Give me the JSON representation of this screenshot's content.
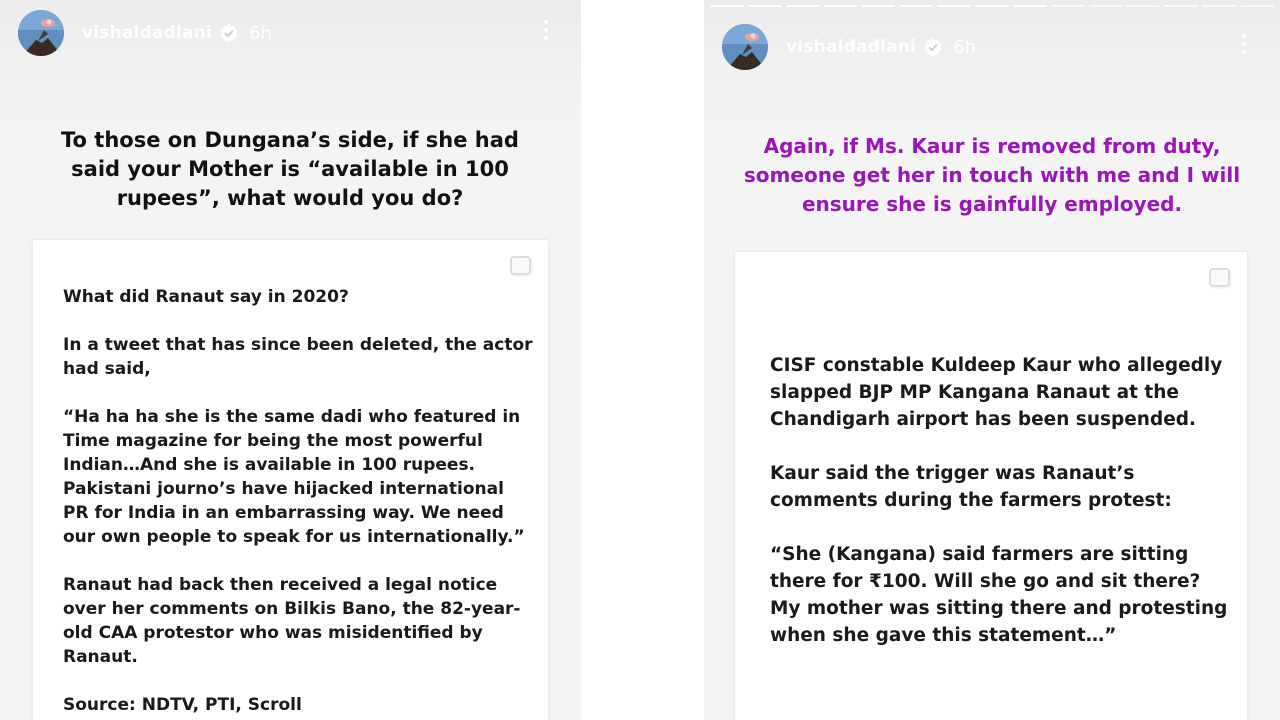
{
  "stories": {
    "left": {
      "username": "vishaldadlani",
      "time": "6h",
      "caption": "To those on Dungana’s side, if she had said your Mother is “available in 100 rupees”, what would you do?",
      "card": {
        "heading": "What did Ranaut say in 2020?",
        "p1": "In a tweet that has since been deleted, the actor had said,",
        "quote": "“Ha ha ha she is the same dadi who featured in Time magazine for being the most powerful Indian…And she is available in 100 rupees. Pakistani journo’s have hijacked international PR for India in an embarrassing way. We need our own people to speak for us internationally.”",
        "p3": "Ranaut had back then received a legal notice over her comments on Bilkis Bano, the 82-year-old CAA protestor who was misidentified by Ranaut.",
        "source": "Source: NDTV, PTI, Scroll"
      }
    },
    "right": {
      "username": "vishaldadlani",
      "time": "6h",
      "progress": {
        "segments": 15,
        "completed": 9
      },
      "caption": "Again, if Ms. Kaur is removed from duty, someone get her in touch with me and I will ensure she is gainfully employed.",
      "caption_color": "#9b16b8",
      "card": {
        "p1": "CISF constable Kuldeep Kaur who allegedly slapped BJP MP Kangana Ranaut at the Chandigarh airport has been suspended.",
        "p2": "Kaur said the trigger was Ranaut’s comments during the farmers protest:",
        "quote": "“She (Kangana) said farmers are sitting there for ₹100. Will she go and sit there? My mother was sitting there and protesting when she gave this statement…”"
      }
    }
  },
  "icons": [
    "avatar",
    "verified-badge-icon",
    "more-options-icon",
    "card-icon"
  ]
}
